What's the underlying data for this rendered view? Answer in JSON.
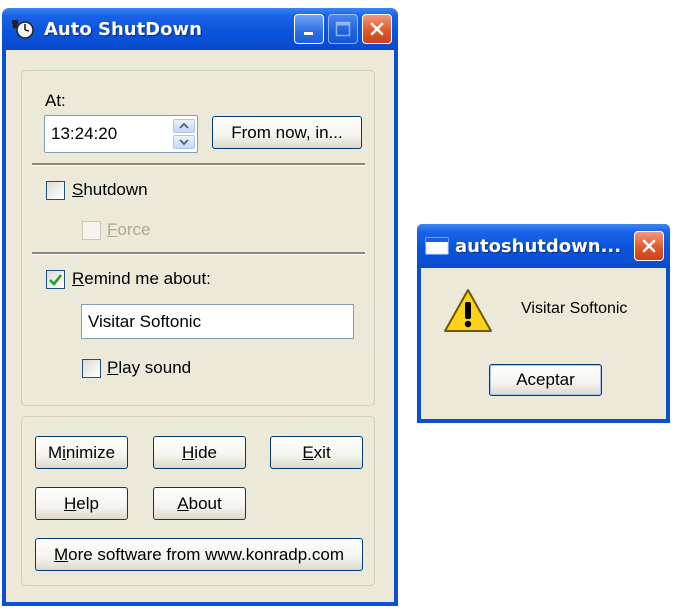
{
  "main_window": {
    "title": "Auto ShutDown",
    "at_label": "At:",
    "time_value": "13:24:20",
    "from_now_button": "From now, in...",
    "shutdown": {
      "label_prefix": "",
      "mnemonic": "S",
      "label_rest": "hutdown",
      "checked": false
    },
    "force": {
      "mnemonic": "F",
      "label_rest": "orce",
      "checked": false,
      "enabled": false
    },
    "remind": {
      "mnemonic": "R",
      "label_rest": "emind me about:",
      "checked": true
    },
    "remind_text": "Visitar Softonic",
    "play_sound": {
      "mnemonic": "P",
      "label_rest": "lay sound",
      "checked": false
    },
    "buttons": {
      "minimize": {
        "pre": "M",
        "mn": "i",
        "post": "nimize"
      },
      "hide": {
        "pre": "",
        "mn": "H",
        "post": "ide"
      },
      "exit": {
        "pre": "",
        "mn": "E",
        "post": "xit"
      },
      "help": {
        "pre": "",
        "mn": "H",
        "post": "elp"
      },
      "about": {
        "pre": "",
        "mn": "A",
        "post": "bout"
      },
      "more": {
        "pre": "",
        "mn": "M",
        "post": "ore software from www.konradp.com"
      }
    }
  },
  "dialog": {
    "title": "autoshutdown...",
    "message": "Visitar Softonic",
    "ok_button": "Aceptar",
    "icon": "warning-icon"
  },
  "colors": {
    "titlebar_blue": "#0a54dc",
    "window_face": "#ece9d8",
    "close_red": "#e0582c",
    "check_green": "#21a121"
  }
}
